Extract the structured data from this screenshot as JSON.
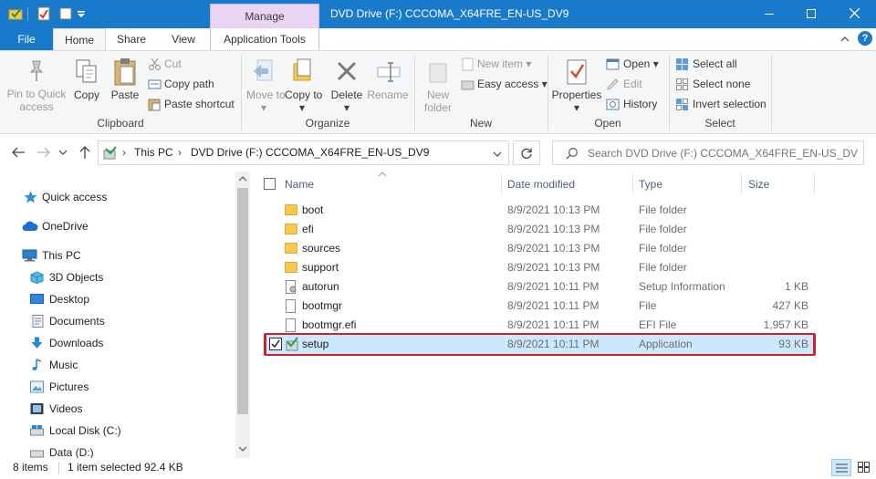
{
  "window": {
    "title": "DVD Drive (F:) CCCOMA_X64FRE_EN-US_DV9",
    "contextual_tab": "Manage"
  },
  "ribbon_tabs": [
    "File",
    "Home",
    "Share",
    "View",
    "Application Tools"
  ],
  "ribbon": {
    "clipboard": {
      "pin_label": "Pin to Quick access",
      "copy_label": "Copy",
      "paste_label": "Paste",
      "cut_label": "Cut",
      "copy_path_label": "Copy path",
      "paste_shortcut_label": "Paste shortcut",
      "group_label": "Clipboard"
    },
    "organize": {
      "move_to_label": "Move to",
      "copy_to_label": "Copy to",
      "delete_label": "Delete",
      "rename_label": "Rename",
      "group_label": "Organize"
    },
    "new": {
      "new_folder_label": "New folder",
      "new_item_label": "New item",
      "easy_access_label": "Easy access",
      "group_label": "New"
    },
    "open": {
      "properties_label": "Properties",
      "open_label": "Open",
      "edit_label": "Edit",
      "history_label": "History",
      "group_label": "Open"
    },
    "select": {
      "select_all_label": "Select all",
      "select_none_label": "Select none",
      "invert_selection_label": "Invert selection",
      "group_label": "Select"
    }
  },
  "address": {
    "segments": [
      "This PC",
      "DVD Drive (F:) CCCOMA_X64FRE_EN-US_DV9"
    ]
  },
  "search": {
    "placeholder": "Search DVD Drive (F:) CCCOMA_X64FRE_EN-US_DV9"
  },
  "nav": [
    {
      "label": "Quick access",
      "icon": "star-icon"
    },
    {
      "label": "OneDrive",
      "icon": "cloud-icon"
    },
    {
      "label": "This PC",
      "icon": "computer-icon"
    },
    {
      "label": "3D Objects",
      "icon": "cube-icon"
    },
    {
      "label": "Desktop",
      "icon": "desktop-icon"
    },
    {
      "label": "Documents",
      "icon": "documents-icon"
    },
    {
      "label": "Downloads",
      "icon": "download-icon"
    },
    {
      "label": "Music",
      "icon": "music-icon"
    },
    {
      "label": "Pictures",
      "icon": "pictures-icon"
    },
    {
      "label": "Videos",
      "icon": "videos-icon"
    },
    {
      "label": "Local Disk (C:)",
      "icon": "drive-icon"
    },
    {
      "label": "Data (D:)",
      "icon": "drive-icon"
    }
  ],
  "columns": {
    "name": "Name",
    "date": "Date modified",
    "type": "Type",
    "size": "Size"
  },
  "files": [
    {
      "name": "boot",
      "date": "8/9/2021 10:13 PM",
      "type": "File folder",
      "size": "",
      "icon": "folder-icon"
    },
    {
      "name": "efi",
      "date": "8/9/2021 10:13 PM",
      "type": "File folder",
      "size": "",
      "icon": "folder-icon"
    },
    {
      "name": "sources",
      "date": "8/9/2021 10:13 PM",
      "type": "File folder",
      "size": "",
      "icon": "folder-icon"
    },
    {
      "name": "support",
      "date": "8/9/2021 10:13 PM",
      "type": "File folder",
      "size": "",
      "icon": "folder-icon"
    },
    {
      "name": "autorun",
      "date": "8/9/2021 10:11 PM",
      "type": "Setup Information",
      "size": "1 KB",
      "icon": "setup-info-icon"
    },
    {
      "name": "bootmgr",
      "date": "8/9/2021 10:11 PM",
      "type": "File",
      "size": "427 KB",
      "icon": "file-icon"
    },
    {
      "name": "bootmgr.efi",
      "date": "8/9/2021 10:11 PM",
      "type": "EFI File",
      "size": "1,957 KB",
      "icon": "file-icon"
    },
    {
      "name": "setup",
      "date": "8/9/2021 10:11 PM",
      "type": "Application",
      "size": "93 KB",
      "icon": "setup-app-icon",
      "selected": true
    }
  ],
  "status": {
    "items_count": "8 items",
    "selection": "1 item selected  92.4 KB"
  },
  "colors": {
    "titlebar": "#1979ca",
    "manage_tab": "#e9d4f3",
    "selection_fill": "#cce8ff",
    "highlight_outline": "#d0202a"
  }
}
